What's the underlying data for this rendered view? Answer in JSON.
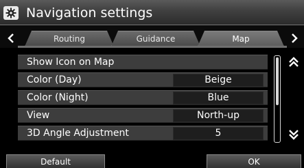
{
  "window": {
    "title": "Navigation settings",
    "icon": "gear-icon"
  },
  "tabs": [
    {
      "label": "Routing",
      "active": false
    },
    {
      "label": "Guidance",
      "active": false
    },
    {
      "label": "Map",
      "active": true
    }
  ],
  "settings": [
    {
      "label": "Show Icon on Map",
      "value": null
    },
    {
      "label": "Color (Day)",
      "value": "Beige"
    },
    {
      "label": "Color (Night)",
      "value": "Blue"
    },
    {
      "label": "View",
      "value": "North-up"
    },
    {
      "label": "3D Angle Adjustment",
      "value": "5"
    }
  ],
  "footer": {
    "default_label": "Default",
    "ok_label": "OK"
  },
  "icons": {
    "tab_prev": "chevron-left-icon",
    "tab_next": "chevron-right-icon",
    "scroll_up": "double-chevron-up-icon",
    "scroll_down": "double-chevron-down-icon"
  },
  "colors": {
    "titlebar": "#3f3f3f",
    "row": "#3d3d3d",
    "value_box": "#1e1e1e",
    "background": "#000000"
  }
}
